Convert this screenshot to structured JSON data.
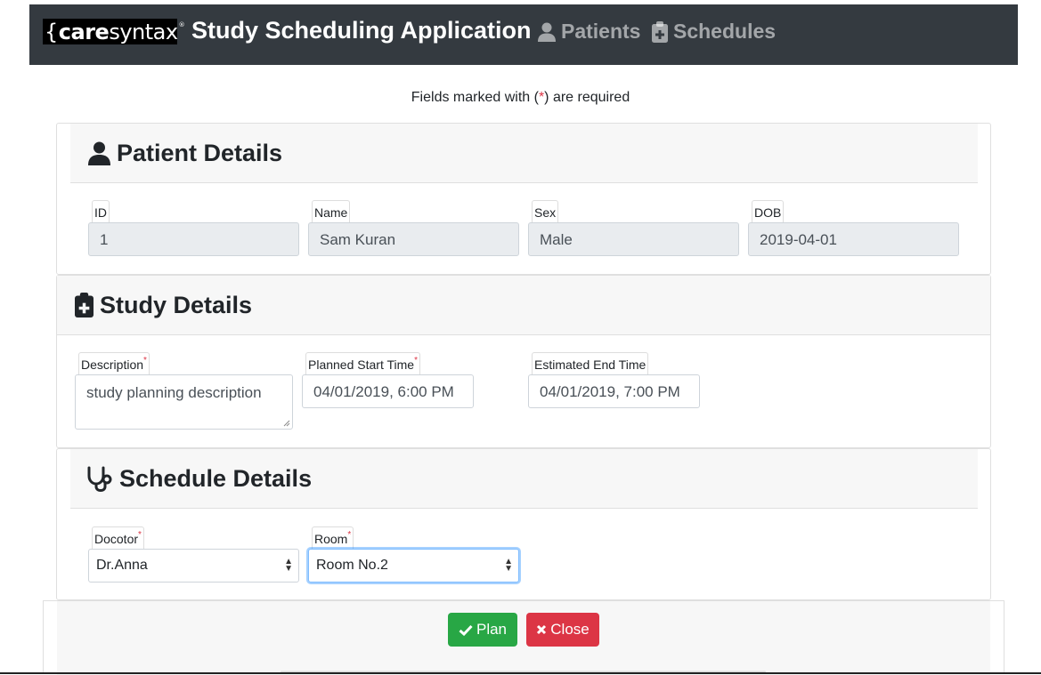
{
  "navbar": {
    "logo": {
      "brace": "{",
      "care": "care",
      "syntax": "syntax",
      "registered": "®"
    },
    "title": "Study Scheduling Application",
    "links": [
      {
        "label": "Patients",
        "icon": "user-icon"
      },
      {
        "label": "Schedules",
        "icon": "clipboard-medical-icon"
      }
    ]
  },
  "required_note": {
    "before": "Fields marked with (",
    "star": "*",
    "after": ") are required"
  },
  "patient_details": {
    "title": "Patient Details",
    "fields": {
      "id": {
        "label": "ID",
        "value": "1"
      },
      "name": {
        "label": "Name",
        "value": "Sam Kuran"
      },
      "sex": {
        "label": "Sex",
        "value": "Male"
      },
      "dob": {
        "label": "DOB",
        "value": "2019-04-01"
      }
    }
  },
  "study_details": {
    "title": "Study Details",
    "fields": {
      "description": {
        "label": "Description",
        "required": "*",
        "value": "study planning description"
      },
      "start": {
        "label": "Planned Start Time",
        "required": "*",
        "value": "04/01/2019, 6:00 PM"
      },
      "end": {
        "label": "Estimated End Time",
        "value": "04/01/2019, 7:00 PM"
      }
    }
  },
  "schedule_details": {
    "title": "Schedule Details",
    "fields": {
      "doctor": {
        "label": "Docotor",
        "required": "*",
        "value": "Dr.Anna"
      },
      "room": {
        "label": "Room",
        "required": "*",
        "value": "Room No.2"
      }
    }
  },
  "actions": {
    "plan": "Plan",
    "close": "Close"
  },
  "colors": {
    "navbar": "#343a40",
    "plan": "#28a745",
    "close": "#dc3545",
    "required": "#dc3545"
  }
}
